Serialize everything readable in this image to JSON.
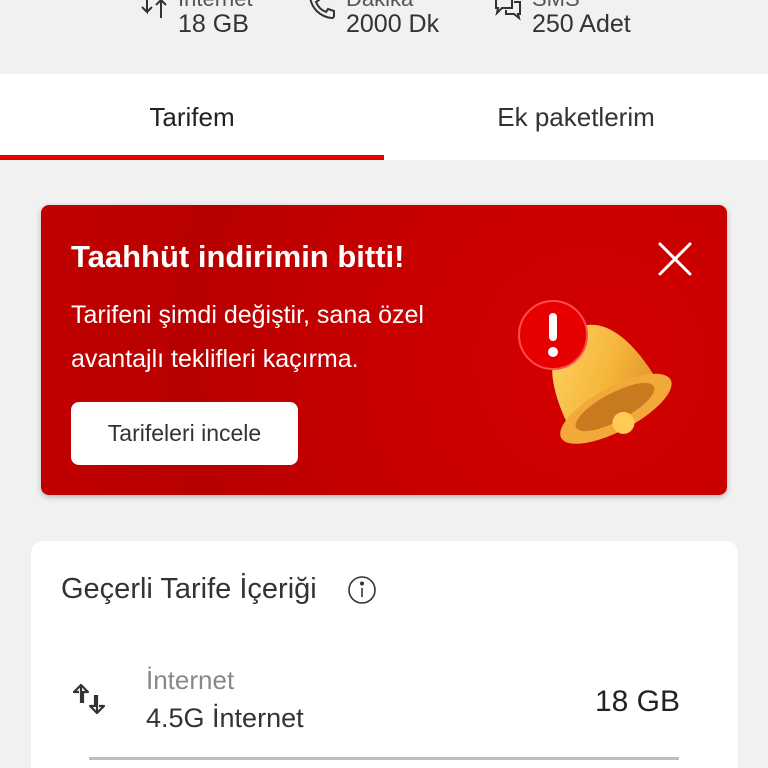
{
  "summary": {
    "internet": {
      "label": "İnternet",
      "value": "18 GB",
      "icon": "data-transfer-icon"
    },
    "minutes": {
      "label": "Dakika",
      "value": "2000 Dk",
      "icon": "phone-icon"
    },
    "sms": {
      "label": "SMS",
      "value": "250 Adet",
      "icon": "chat-icon"
    }
  },
  "tabs": [
    {
      "label": "Tarifem",
      "active": true
    },
    {
      "label": "Ek paketlerim",
      "active": false
    }
  ],
  "promo": {
    "title": "Taahhüt indirimin bitti!",
    "description": "Tarifeni şimdi değiştir, sana özel avantajlı teklifleri kaçırma.",
    "cta_label": "Tarifeleri incele",
    "icon": "bell-alert-icon",
    "background_color": "#c60000"
  },
  "tariff_card": {
    "title": "Geçerli Tarife İçeriği",
    "items": [
      {
        "type_label": "İnternet",
        "name": "4.5G İnternet",
        "value": "18 GB",
        "icon": "data-transfer-icon"
      }
    ]
  },
  "colors": {
    "accent": "#e60000"
  }
}
